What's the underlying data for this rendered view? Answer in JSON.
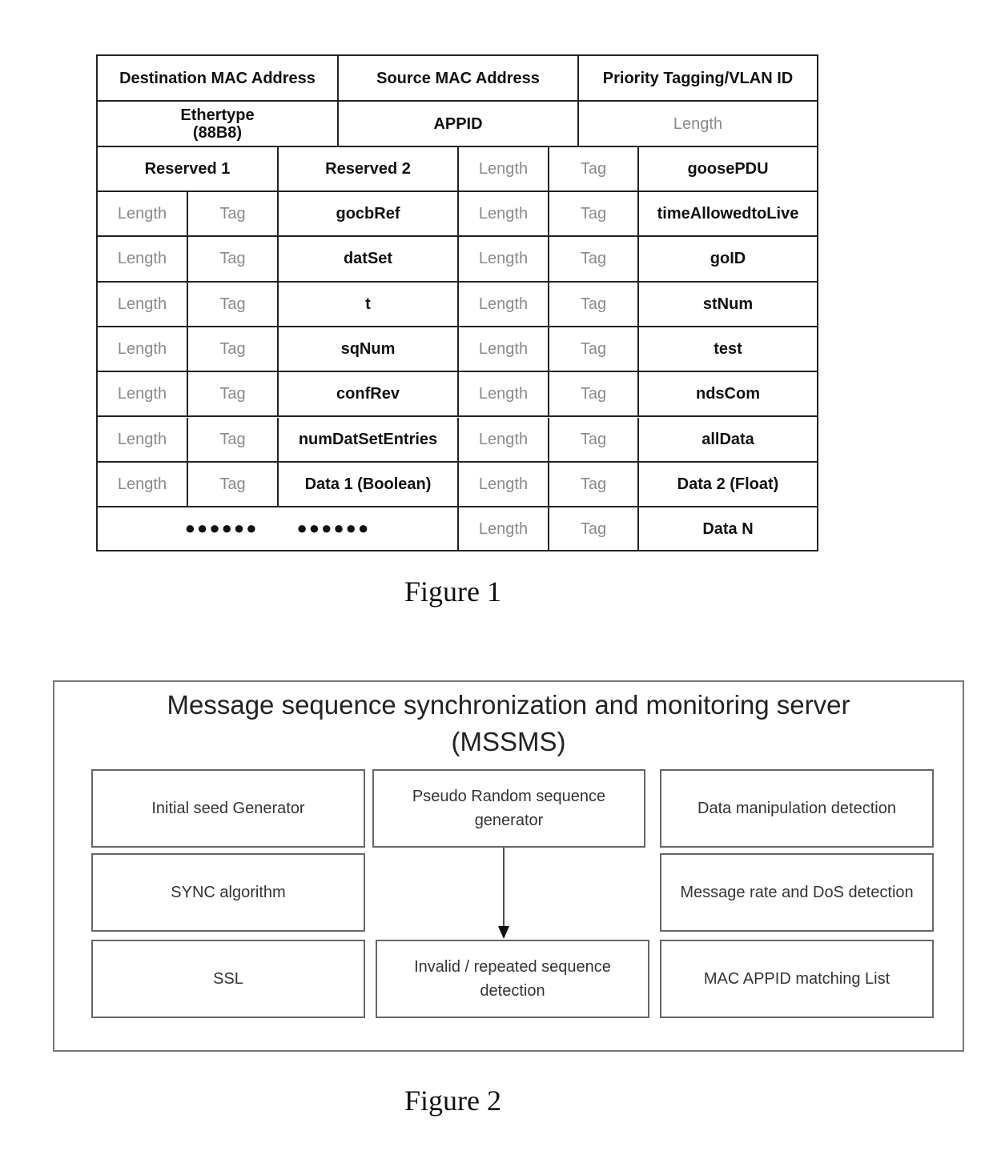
{
  "figure1": {
    "caption": "Figure 1",
    "row1": [
      "Destination MAC Address",
      "Source MAC Address",
      "Priority Tagging/VLAN ID"
    ],
    "row2": {
      "ethertype": "Ethertype",
      "ethertype_value": "(88B8)",
      "appid": "APPID",
      "length": "Length"
    },
    "row3": [
      "Reserved 1",
      "Reserved 2",
      "Length",
      "Tag",
      "goosePDU"
    ],
    "rows": [
      [
        "Length",
        "Tag",
        "gocbRef",
        "Length",
        "Tag",
        "timeAllowedtoLive"
      ],
      [
        "Length",
        "Tag",
        "datSet",
        "Length",
        "Tag",
        "goID"
      ],
      [
        "Length",
        "Tag",
        "t",
        "Length",
        "Tag",
        "stNum"
      ],
      [
        "Length",
        "Tag",
        "sqNum",
        "Length",
        "Tag",
        "test"
      ],
      [
        "Length",
        "Tag",
        "confRev",
        "Length",
        "Tag",
        "ndsCom"
      ],
      [
        "Length",
        "Tag",
        "numDatSetEntries",
        "Length",
        "Tag",
        "allData"
      ],
      [
        "Length",
        "Tag",
        "Data 1 (Boolean)",
        "Length",
        "Tag",
        "Data 2 (Float)"
      ]
    ],
    "last_row": {
      "dots1": "●●●●●●",
      "dots2": "●●●●●●",
      "length": "Length",
      "tag": "Tag",
      "data": "Data N"
    }
  },
  "figure2": {
    "caption": "Figure 2",
    "title_line1": "Message sequence synchronization and monitoring server",
    "title_line2": "(MSSMS)",
    "boxes": {
      "initial_seed": "Initial seed Generator",
      "prng": "Pseudo Random sequence generator",
      "data_manipulation": "Data manipulation detection",
      "sync": "SYNC algorithm",
      "msg_rate": "Message rate and DoS detection",
      "ssl": "SSL",
      "invalid_seq": "Invalid / repeated  sequence detection",
      "mac_appid": "MAC APPID matching List"
    }
  }
}
